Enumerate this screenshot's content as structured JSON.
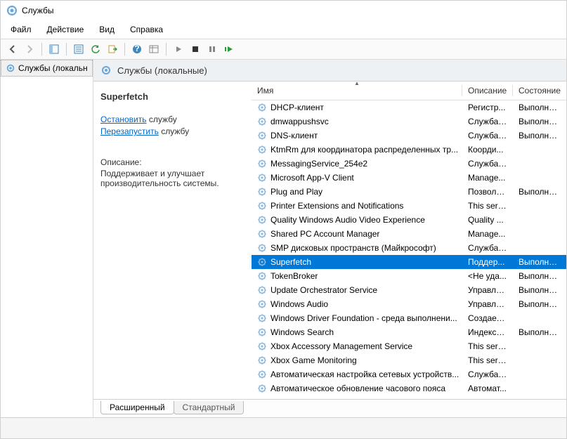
{
  "window": {
    "title": "Службы"
  },
  "menu": {
    "file": "Файл",
    "action": "Действие",
    "view": "Вид",
    "help": "Справка"
  },
  "tree": {
    "root": "Службы (локальн"
  },
  "header": {
    "title": "Службы (локальные)"
  },
  "detail": {
    "selected_name": "Superfetch",
    "stop_link": "Остановить",
    "restart_link": "Перезапустить",
    "service_word": "службу",
    "desc_label": "Описание:",
    "desc_text": "Поддерживает и улучшает производительность системы."
  },
  "columns": {
    "name": "Имя",
    "description": "Описание",
    "state": "Состояние"
  },
  "services": [
    {
      "name": "DHCP-клиент",
      "desc": "Регистр...",
      "state": "Выполняет"
    },
    {
      "name": "dmwappushsvc",
      "desc": "Служба ...",
      "state": "Выполняет"
    },
    {
      "name": "DNS-клиент",
      "desc": "Служба ...",
      "state": "Выполняет"
    },
    {
      "name": "KtmRm для координатора распределенных тр...",
      "desc": "Коорди...",
      "state": ""
    },
    {
      "name": "MessagingService_254e2",
      "desc": "Служба,...",
      "state": ""
    },
    {
      "name": "Microsoft App-V Client",
      "desc": "Manage...",
      "state": ""
    },
    {
      "name": "Plug and Play",
      "desc": "Позволя...",
      "state": "Выполняет"
    },
    {
      "name": "Printer Extensions and Notifications",
      "desc": "This serv...",
      "state": ""
    },
    {
      "name": "Quality Windows Audio Video Experience",
      "desc": "Quality ...",
      "state": ""
    },
    {
      "name": "Shared PC Account Manager",
      "desc": "Manage...",
      "state": ""
    },
    {
      "name": "SMP дисковых пространств (Майкрософт)",
      "desc": "Служба ...",
      "state": ""
    },
    {
      "name": "Superfetch",
      "desc": "Поддер...",
      "state": "Выполняет",
      "selected": true
    },
    {
      "name": "TokenBroker",
      "desc": "<Не уда...",
      "state": "Выполняет"
    },
    {
      "name": "Update Orchestrator Service",
      "desc": "Управля...",
      "state": "Выполняет"
    },
    {
      "name": "Windows Audio",
      "desc": "Управля...",
      "state": "Выполняет"
    },
    {
      "name": "Windows Driver Foundation - среда выполнени...",
      "desc": "Создает ...",
      "state": ""
    },
    {
      "name": "Windows Search",
      "desc": "Индекси...",
      "state": "Выполняет"
    },
    {
      "name": "Xbox Accessory Management Service",
      "desc": "This serv...",
      "state": ""
    },
    {
      "name": "Xbox Game Monitoring",
      "desc": "This serv...",
      "state": ""
    },
    {
      "name": "Автоматическая настройка сетевых устройств...",
      "desc": "Служба ...",
      "state": ""
    },
    {
      "name": "Автоматическое обновление часового пояса",
      "desc": "Автомат...",
      "state": ""
    }
  ],
  "tabs": {
    "extended": "Расширенный",
    "standard": "Стандартный"
  }
}
